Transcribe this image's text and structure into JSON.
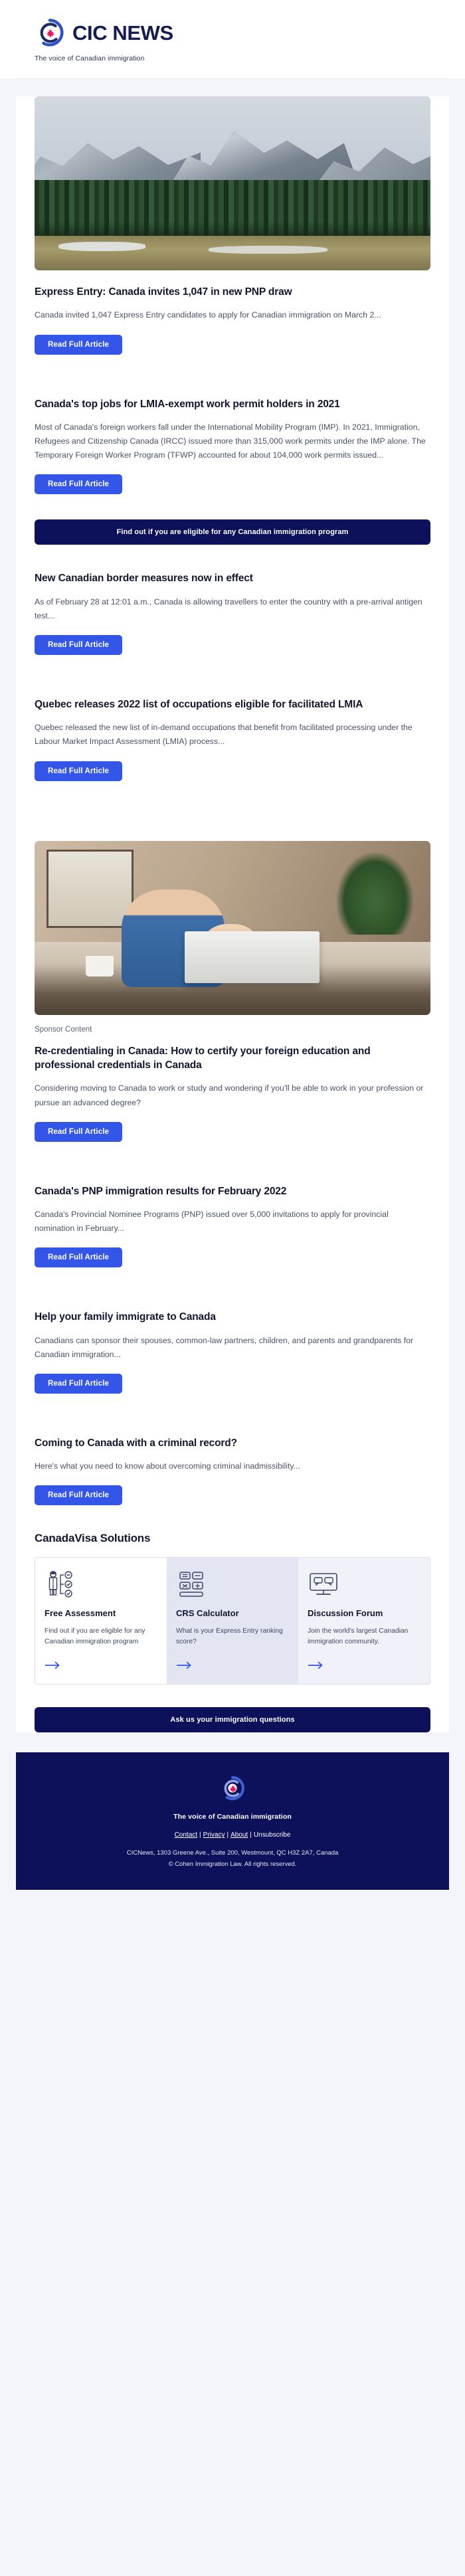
{
  "header": {
    "brand_name": "CIC NEWS",
    "tagline": "The voice of Canadian immigration",
    "logo_icon": "cic-circular-maple-leaf-logo"
  },
  "colors": {
    "accent_blue": "#3355e8",
    "navy": "#0c1159",
    "page_bg": "#f4f5fb",
    "card_bg": "#ffffff",
    "body_text": "#4a5068",
    "heading_text": "#12162e"
  },
  "buttons": {
    "read_full_article": "Read Full Article",
    "eligibility_cta": "Find out if you are eligible for any Canadian immigration program",
    "ask_cta": "Ask us your immigration questions"
  },
  "labels": {
    "sponsor_content": "Sponsor Content"
  },
  "articles": [
    {
      "has_image": true,
      "image_name": "canadian-rockies-mountain-photo",
      "title": "Express Entry: Canada invites 1,047 in new PNP draw",
      "excerpt": "Canada invited 1,047 Express Entry candidates to apply for Canadian immigration on March 2...",
      "button": "Read Full Article"
    },
    {
      "has_image": false,
      "title": "Canada's top jobs for LMIA-exempt work permit holders in 2021",
      "excerpt": "Most of Canada's foreign workers fall under the International Mobility Program (IMP). In 2021, Immigration, Refugees and Citizenship Canada (IRCC) issued more than 315,000 work permits under the IMP alone. The Temporary Foreign Worker Program (TFWP) accounted for about 104,000 work permits issued...",
      "button": "Read Full Article"
    },
    {
      "has_image": false,
      "title": "New Canadian border measures now in effect",
      "excerpt": "As of February 28 at 12:01 a.m., Canada is allowing travellers to enter the country with a pre-arrival antigen test...",
      "button": "Read Full Article"
    },
    {
      "has_image": false,
      "title": "Quebec releases 2022 list of occupations eligible for facilitated LMIA",
      "excerpt": "Quebec released the new list of in-demand occupations that benefit from facilitated processing under the Labour Market Impact Assessment (LMIA) process...",
      "button": "Read Full Article"
    },
    {
      "has_image": true,
      "image_name": "man-with-baby-at-laptop-photo",
      "sponsor": "Sponsor Content",
      "title": "Re-credentialing in Canada: How to certify your foreign education and professional credentials in Canada",
      "excerpt": "Considering moving to Canada to work or study and wondering if you'll be able to work in your profession or pursue an advanced degree?",
      "button": "Read Full Article"
    },
    {
      "has_image": false,
      "title": "Canada's PNP immigration results for February 2022",
      "excerpt": "Canada's Provincial Nominee Programs (PNP) issued over 5,000 invitations to apply for provincial nomination in February...",
      "button": "Read Full Article"
    },
    {
      "has_image": false,
      "title": "Help your family immigrate to Canada",
      "excerpt": "Canadians can sponsor their spouses, common-law partners, children, and parents and grandparents for Canadian immigration...",
      "button": "Read Full Article"
    },
    {
      "has_image": false,
      "title": "Coming to Canada with a criminal record?",
      "excerpt": "Here's what you need to know about overcoming criminal inadmissibility...",
      "button": "Read Full Article"
    }
  ],
  "solutions": {
    "title": "CanadaVisa Solutions",
    "cards": [
      {
        "icon": "person-checklist-icon",
        "name": "Free Assessment",
        "desc": "Find out if you are eligible for any Canadian immigration program"
      },
      {
        "icon": "calculator-icon",
        "name": "CRS Calculator",
        "desc": "What is your Express Entry ranking score?"
      },
      {
        "icon": "discussion-monitor-icon",
        "name": "Discussion Forum",
        "desc": "Join the world's largest Canadian immigration community."
      }
    ],
    "arrow_icon": "arrow-right-icon"
  },
  "footer": {
    "logo_icon": "cic-circular-maple-leaf-logo",
    "tagline": "The voice of Canadian immigration",
    "links": [
      {
        "label": "Contact",
        "underlined": true
      },
      {
        "label": "Privacy",
        "underlined": true
      },
      {
        "label": "About",
        "underlined": true
      },
      {
        "label": "Unsubscribe",
        "underlined": false
      }
    ],
    "separator": "|",
    "address": "CICNews, 1303 Greene Ave., Suite 200, Westmount, QC H3Z 2A7, Canada",
    "copyright": "© Cohen Immigration Law. All rights reserved."
  }
}
